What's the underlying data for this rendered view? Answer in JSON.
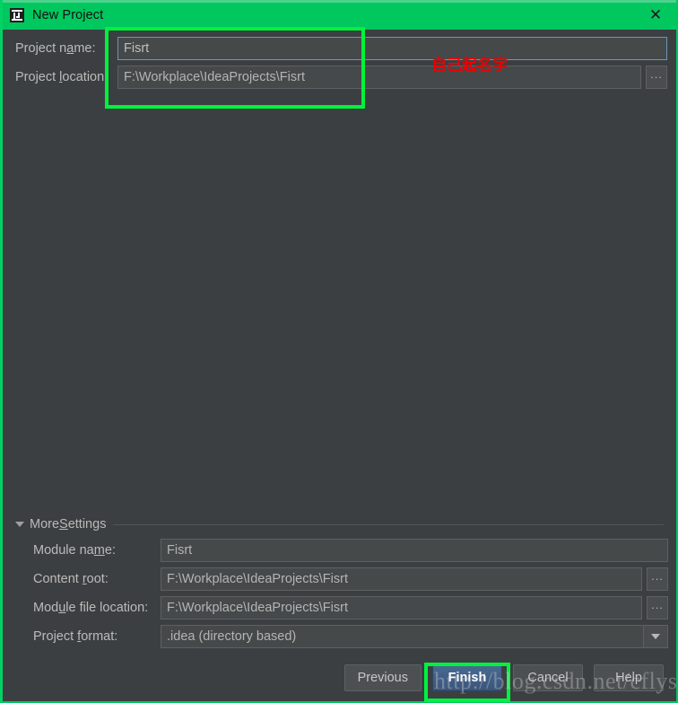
{
  "window": {
    "title": "New Project",
    "icon": "intellij-idea-icon",
    "close_label": "✕",
    "title_bar_color": "#00c85f",
    "background_color": "#3c3f41"
  },
  "top_form": {
    "rows": [
      {
        "label_pre": "Project n",
        "label_mn": "a",
        "label_post": "me:",
        "value": "Fisrt",
        "focused": true,
        "has_browse": false
      },
      {
        "label_pre": "Project ",
        "label_mn": "l",
        "label_post": "ocation:",
        "value": "F:\\Workplace\\IdeaProjects\\Fisrt",
        "focused": false,
        "has_browse": true,
        "browse_label": "..."
      }
    ]
  },
  "annotations": {
    "red_note": "自己起名字",
    "highlight_color": "#00f23c"
  },
  "more_settings": {
    "header_pre": "More",
    "header_mn": "S",
    "header_post": "ettings",
    "expanded": true,
    "rows": [
      {
        "label_pre": "Module na",
        "label_mn": "m",
        "label_post": "e:",
        "value": "Fisrt",
        "control": "text"
      },
      {
        "label_pre": "Content ",
        "label_mn": "r",
        "label_post": "oot:",
        "value": "F:\\Workplace\\IdeaProjects\\Fisrt",
        "control": "text-browse",
        "browse_label": "..."
      },
      {
        "label_pre": "Mod",
        "label_mn": "u",
        "label_post": "le file location:",
        "value": "F:\\Workplace\\IdeaProjects\\Fisrt",
        "control": "text-browse",
        "browse_label": "..."
      },
      {
        "label_pre": "Project ",
        "label_mn": "f",
        "label_post": "ormat:",
        "value": ".idea (directory based)",
        "control": "combo"
      }
    ]
  },
  "buttons": {
    "previous": "Previous",
    "finish": "Finish",
    "cancel": "Cancel",
    "help": "Help"
  },
  "watermark": {
    "text": "http://blog.csdn.net/cflys"
  }
}
